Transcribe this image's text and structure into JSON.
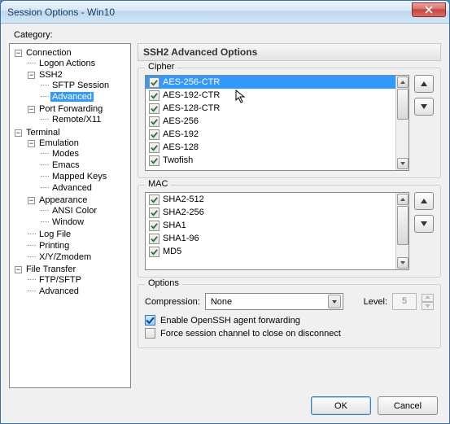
{
  "window": {
    "title": "Session Options - Win10"
  },
  "category_label": "Category:",
  "tree": {
    "connection": "Connection",
    "logon_actions": "Logon Actions",
    "ssh2": "SSH2",
    "sftp_session": "SFTP Session",
    "advanced": "Advanced",
    "port_forwarding": "Port Forwarding",
    "remote_x11": "Remote/X11",
    "terminal": "Terminal",
    "emulation": "Emulation",
    "modes": "Modes",
    "emacs": "Emacs",
    "mapped_keys": "Mapped Keys",
    "advanced2": "Advanced",
    "appearance": "Appearance",
    "ansi_color": "ANSI Color",
    "window": "Window",
    "log_file": "Log File",
    "printing": "Printing",
    "xyzmodem": "X/Y/Zmodem",
    "file_transfer": "File Transfer",
    "ftp_sftp": "FTP/SFTP",
    "advanced3": "Advanced"
  },
  "panel": {
    "title": "SSH2 Advanced Options"
  },
  "cipher": {
    "label": "Cipher",
    "items": [
      "AES-256-CTR",
      "AES-192-CTR",
      "AES-128-CTR",
      "AES-256",
      "AES-192",
      "AES-128",
      "Twofish"
    ]
  },
  "mac": {
    "label": "MAC",
    "items": [
      "SHA2-512",
      "SHA2-256",
      "SHA1",
      "SHA1-96",
      "MD5"
    ]
  },
  "options": {
    "label": "Options",
    "compression_label": "Compression:",
    "compression_value": "None",
    "level_label": "Level:",
    "level_value": "5",
    "enable_agent": "Enable OpenSSH agent forwarding",
    "force_close": "Force session channel to close on disconnect"
  },
  "buttons": {
    "ok": "OK",
    "cancel": "Cancel"
  }
}
